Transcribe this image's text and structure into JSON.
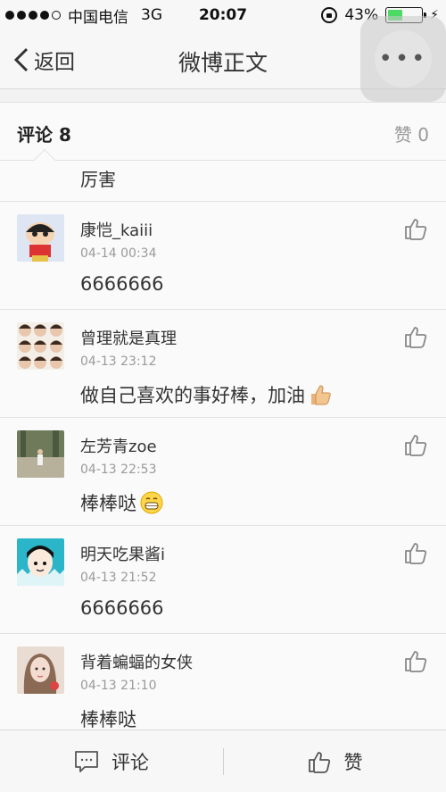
{
  "status_bar": {
    "carrier": "中国电信",
    "network": "3G",
    "time": "20:07",
    "battery": "43%",
    "battery_level": 0.43
  },
  "nav": {
    "back_label": "返回",
    "title": "微博正文"
  },
  "tabs": {
    "comments_label": "评论 8",
    "likes_label": "赞 0"
  },
  "partial_comment": {
    "text": "厉害"
  },
  "comments": [
    {
      "name": "康恺_kaiii",
      "time": "04-14 00:34",
      "text": "6666666"
    },
    {
      "name": "曾理就是真理",
      "time": "04-13 23:12",
      "text": "做自己喜欢的事好棒，加油"
    },
    {
      "name": "左芳青zoe",
      "time": "04-13 22:53",
      "text": "棒棒哒"
    },
    {
      "name": "明天吃果酱i",
      "time": "04-13 21:52",
      "text": "6666666"
    },
    {
      "name": "背着蝙蝠的女侠",
      "time": "04-13 21:10",
      "text": "棒棒哒"
    }
  ],
  "bottom_bar": {
    "comment_label": "评论",
    "like_label": "赞"
  }
}
